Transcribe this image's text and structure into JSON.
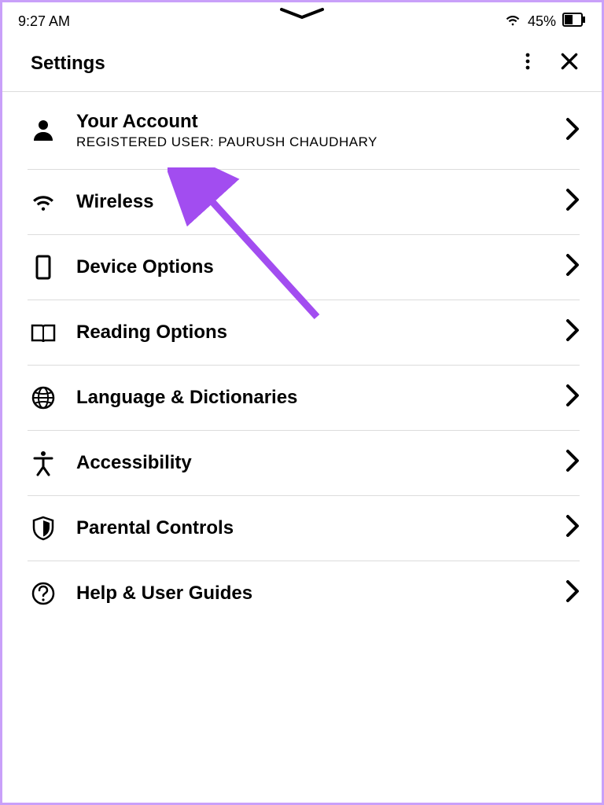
{
  "status": {
    "time": "9:27 AM",
    "battery_pct": "45%"
  },
  "header": {
    "title": "Settings"
  },
  "items": [
    {
      "id": "your-account",
      "title": "Your Account",
      "subtitle": "REGISTERED USER: PAURUSH CHAUDHARY"
    },
    {
      "id": "wireless",
      "title": "Wireless"
    },
    {
      "id": "device-options",
      "title": "Device Options"
    },
    {
      "id": "reading-options",
      "title": "Reading Options"
    },
    {
      "id": "language-dictionaries",
      "title": "Language & Dictionaries"
    },
    {
      "id": "accessibility",
      "title": "Accessibility"
    },
    {
      "id": "parental-controls",
      "title": "Parental Controls"
    },
    {
      "id": "help-guides",
      "title": "Help & User Guides"
    }
  ]
}
